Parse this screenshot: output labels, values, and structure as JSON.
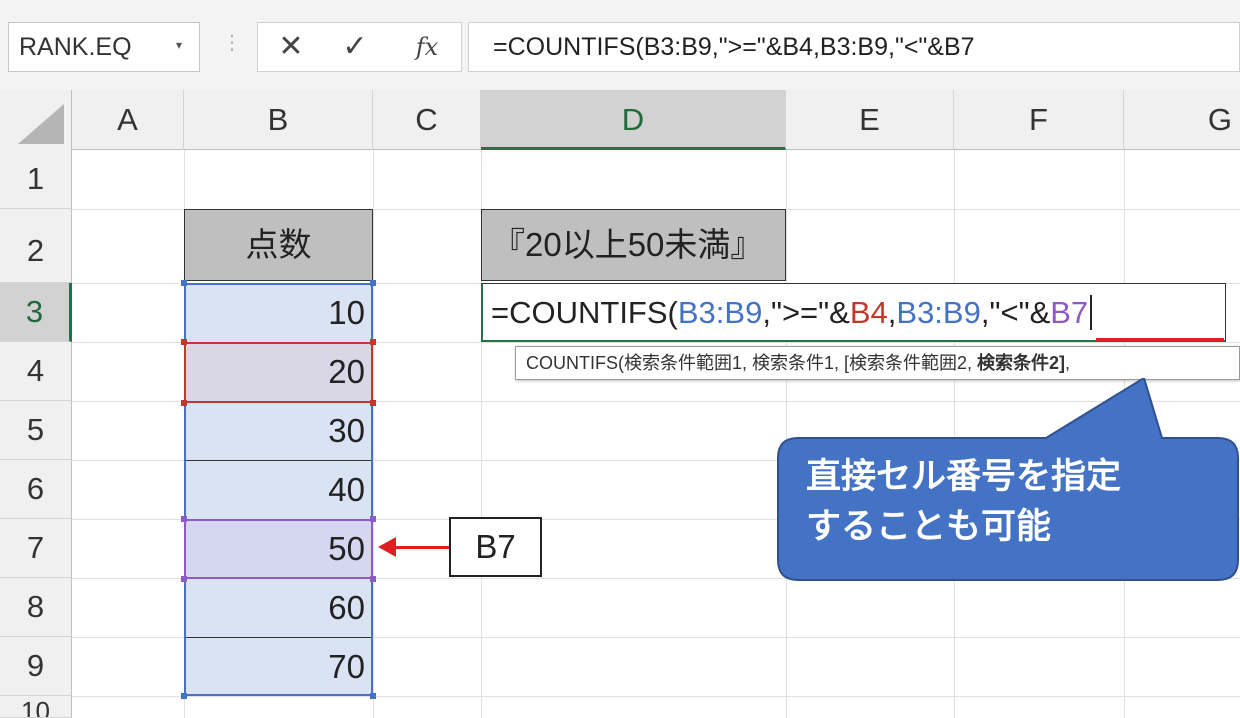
{
  "formula_bar": {
    "name_box": "RANK.EQ",
    "cancel_glyph": "✕",
    "enter_glyph": "✓",
    "fx_glyph": "fx",
    "formula": "=COUNTIFS(B3:B9,\">=\"&B4,B3:B9,\"<\"&B7"
  },
  "columns": [
    "A",
    "B",
    "C",
    "D",
    "E",
    "F",
    "G"
  ],
  "rows": [
    "1",
    "2",
    "3",
    "4",
    "5",
    "6",
    "7",
    "8",
    "9",
    "10"
  ],
  "cells": {
    "b2": "点数",
    "d2": "『20以上50未満』",
    "b_values": [
      "10",
      "20",
      "30",
      "40",
      "50",
      "60",
      "70"
    ]
  },
  "editing": {
    "parts": [
      "=COUNTIFS(",
      "B3:B9",
      ",\">=\"&",
      "B4",
      ",",
      "B3:B9",
      ",\"<\"&",
      "B7"
    ],
    "tooltip_main": "COUNTIFS(検索条件範囲1, 検索条件1, [検索条件範囲2, ",
    "tooltip_bold": "検索条件2]",
    "tooltip_tail": ","
  },
  "annotations": {
    "cell_ref_label": "B7",
    "callout_line1": "直接セル番号を指定",
    "callout_line2": "することも可能",
    "callout_color": "#4472c4",
    "arrow_color": "#e02020"
  },
  "colors": {
    "excel_green": "#217346",
    "ref_blue": "#4472c4",
    "ref_red": "#c0392b",
    "ref_purple": "#8e5ac8"
  }
}
